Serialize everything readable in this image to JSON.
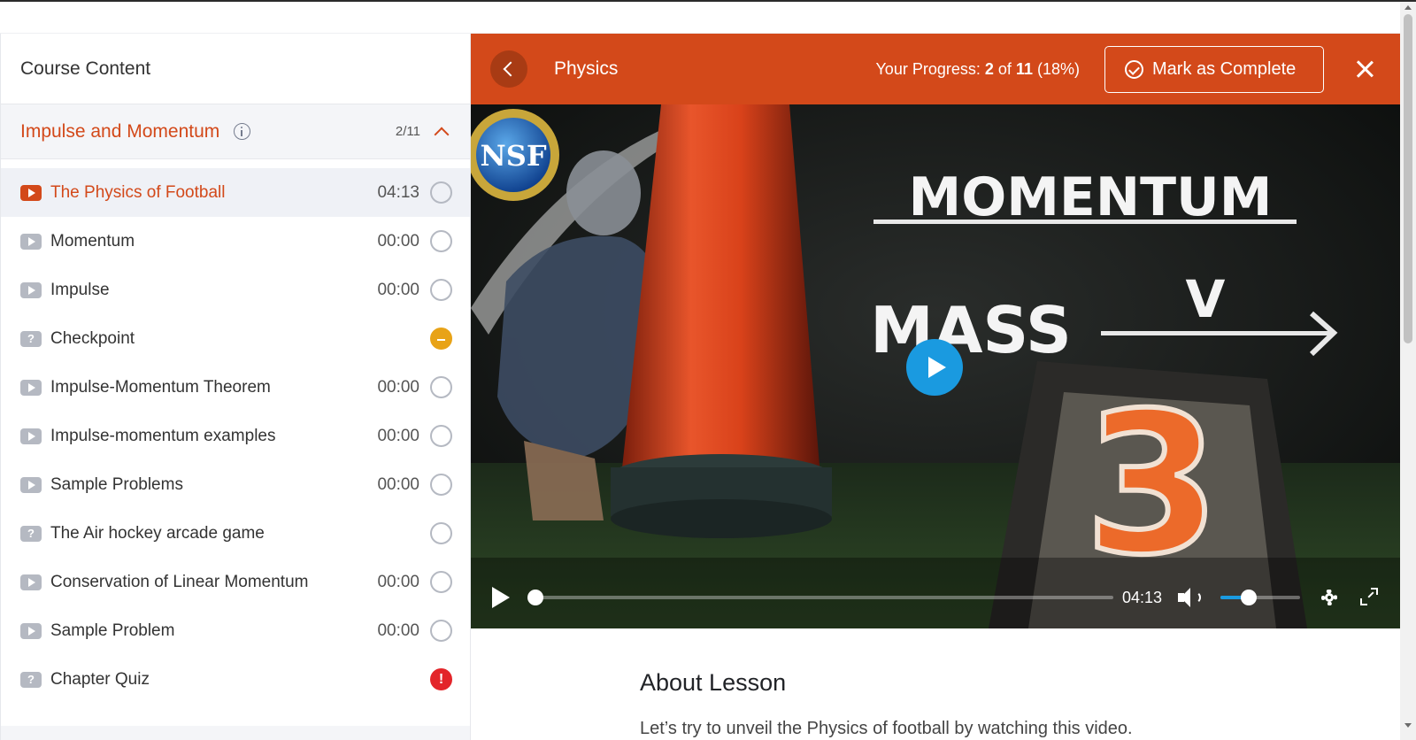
{
  "sidebar": {
    "heading": "Course Content",
    "topic": {
      "title": "Impulse and Momentum",
      "count": "2/11"
    },
    "lessons": [
      {
        "title": "The Physics of Football",
        "time": "04:13",
        "type": "video",
        "status": "none",
        "active": true
      },
      {
        "title": "Momentum",
        "time": "00:00",
        "type": "video",
        "status": "none"
      },
      {
        "title": "Impulse",
        "time": "00:00",
        "type": "video",
        "status": "none"
      },
      {
        "title": "Checkpoint",
        "time": "",
        "type": "quiz",
        "status": "pending"
      },
      {
        "title": "Impulse-Momentum Theorem",
        "time": "00:00",
        "type": "video",
        "status": "none"
      },
      {
        "title": "Impulse-momentum examples",
        "time": "00:00",
        "type": "video",
        "status": "none"
      },
      {
        "title": "Sample Problems",
        "time": "00:00",
        "type": "video",
        "status": "none"
      },
      {
        "title": "The Air hockey arcade game",
        "time": "",
        "type": "quiz",
        "status": "none"
      },
      {
        "title": "Conservation of Linear Momentum",
        "time": "00:00",
        "type": "video",
        "status": "none"
      },
      {
        "title": "Sample Problem",
        "time": "00:00",
        "type": "video",
        "status": "none"
      },
      {
        "title": "Chapter Quiz",
        "time": "",
        "type": "quiz",
        "status": "alert"
      }
    ]
  },
  "header": {
    "title": "Physics",
    "progress_label": "Your Progress:",
    "progress_current": "2",
    "progress_of": "of",
    "progress_total": "11",
    "progress_percent": "(18%)",
    "mark_complete_label": "Mark as Complete"
  },
  "video": {
    "logo_text": "NSF",
    "chalk_title": "MOMENTUM",
    "chalk_mass": "MASS",
    "chalk_v": "V",
    "marker_number": "3",
    "duration": "04:13",
    "seek_fraction": 0,
    "volume_fraction": 0.36
  },
  "about": {
    "heading": "About Lesson",
    "text": "Let’s try to unveil the Physics of football by watching this video."
  },
  "colors": {
    "accent": "#d3491a",
    "player_blue": "#1a9ae0",
    "pending": "#e8a317",
    "alert": "#e3252a"
  }
}
